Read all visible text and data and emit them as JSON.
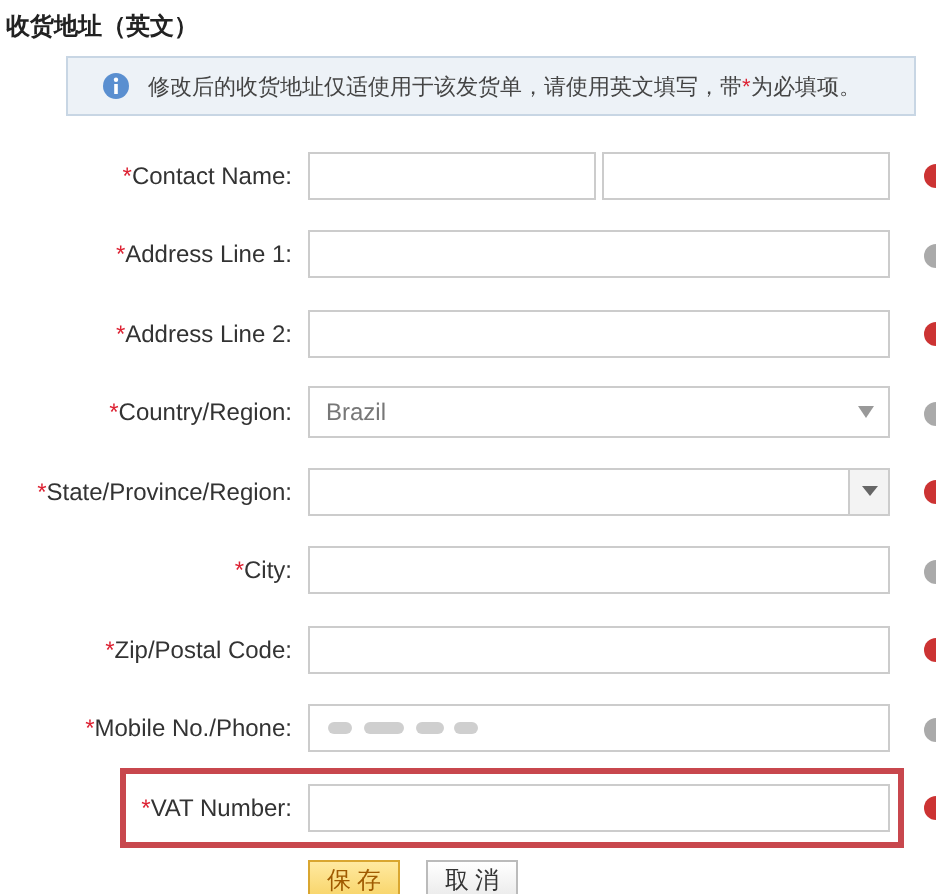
{
  "section_title": "收货地址（英文）",
  "notice": {
    "parts": [
      {
        "text": "修改后的收货地址仅适使用于该发货单，请使用英文填写，带",
        "kind": "plain"
      },
      {
        "text": "*",
        "kind": "mark"
      },
      {
        "text": "为必填项。",
        "kind": "plain"
      }
    ]
  },
  "fields": [
    {
      "mark": "*",
      "label": "Contact Name:",
      "kind": "double",
      "highlighted": false
    },
    {
      "mark": "*",
      "label": "Address Line 1:",
      "kind": "text",
      "highlighted": false
    },
    {
      "mark": "*",
      "label": "Address Line 2:",
      "kind": "text",
      "highlighted": false
    },
    {
      "mark": "*",
      "label": "Country/Region:",
      "kind": "select",
      "value": "Brazil",
      "highlighted": false
    },
    {
      "mark": "*",
      "label": "State/Province/Region:",
      "kind": "combo",
      "highlighted": false
    },
    {
      "mark": "*",
      "label": "City:",
      "kind": "text",
      "highlighted": false
    },
    {
      "mark": "*",
      "label": "Zip/Postal Code:",
      "kind": "text",
      "highlighted": false
    },
    {
      "mark": "*",
      "label": "Mobile No./Phone:",
      "kind": "blurred",
      "highlighted": false
    },
    {
      "mark": "*",
      "label": "VAT Number:",
      "kind": "text",
      "highlighted": true
    }
  ],
  "buttons": [
    {
      "label": "保 存",
      "kind": "primary"
    },
    {
      "label": "取 消",
      "kind": "default"
    }
  ]
}
